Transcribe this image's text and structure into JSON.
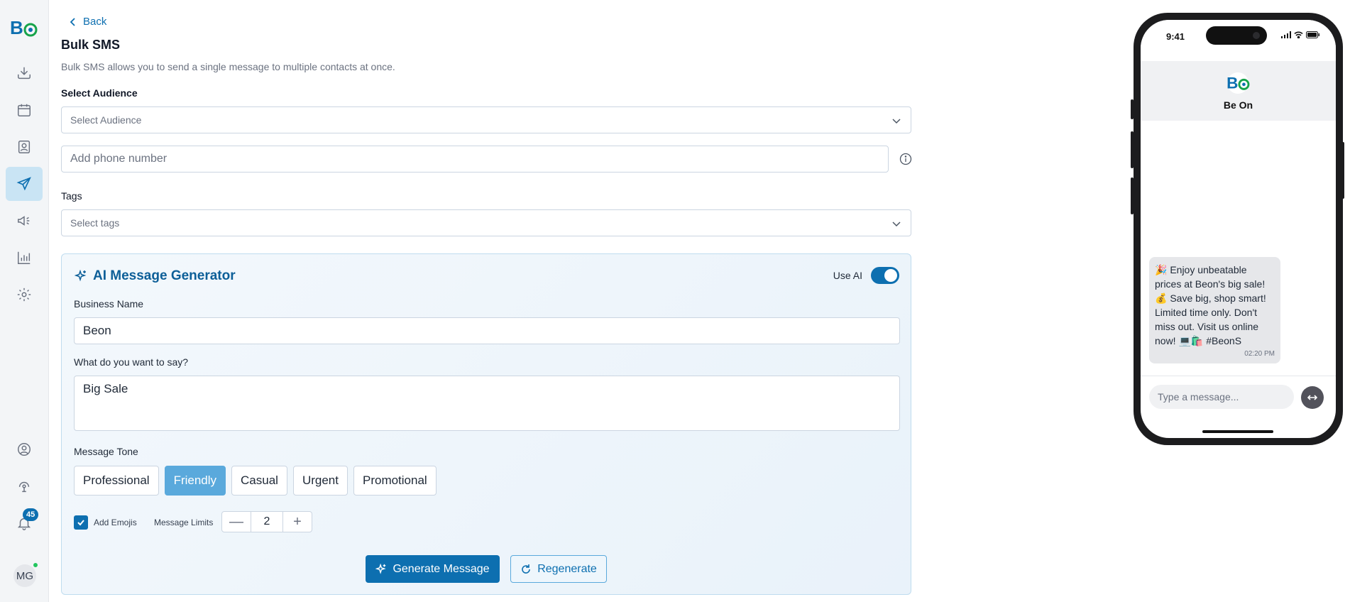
{
  "app": {
    "brand_colors": {
      "primary": "#0d6fb0",
      "primary_light": "#5aa9dc",
      "success": "#22c55e"
    }
  },
  "sidebar": {
    "items": [
      {
        "icon": "inbox-download-icon"
      },
      {
        "icon": "calendar-icon"
      },
      {
        "icon": "contacts-icon"
      },
      {
        "icon": "send-icon",
        "active": true
      },
      {
        "icon": "megaphone-icon"
      },
      {
        "icon": "analytics-icon"
      },
      {
        "icon": "settings-icon"
      },
      {
        "icon": "user-circle-icon"
      },
      {
        "icon": "support-icon"
      },
      {
        "icon": "bell-icon"
      }
    ],
    "notification_count": "45",
    "avatar_initials": "MG"
  },
  "header": {
    "back_label": "Back",
    "title": "Bulk SMS",
    "subtitle": "Bulk SMS allows you to send a single message to multiple contacts at once."
  },
  "form": {
    "audience_label": "Select Audience",
    "audience_placeholder": "Select Audience",
    "phone_placeholder": "Add phone number",
    "tags_label": "Tags",
    "tags_placeholder": "Select tags"
  },
  "ai": {
    "title": "AI Message Generator",
    "use_ai_label": "Use AI",
    "use_ai_enabled": true,
    "business_name_label": "Business Name",
    "business_name_value": "Beon",
    "message_label": "What do you want to say?",
    "message_value": "Big Sale",
    "tone_label": "Message Tone",
    "tones": [
      "Professional",
      "Friendly",
      "Casual",
      "Urgent",
      "Promotional"
    ],
    "selected_tone": "Friendly",
    "add_emojis_label": "Add Emojis",
    "add_emojis_checked": true,
    "message_limits_label": "Message Limits",
    "message_limits_value": "2",
    "generate_label": "Generate Message",
    "regenerate_label": "Regenerate"
  },
  "preview": {
    "time": "9:41",
    "contact_name": "Be On",
    "message_text": "🎉 Enjoy unbeatable prices at Beon's big sale! 💰 Save big, shop smart! Limited time only. Don't miss out. Visit us online now! 💻🛍️ #BeonS",
    "message_time": "02:20 PM",
    "composer_placeholder": "Type a message..."
  }
}
